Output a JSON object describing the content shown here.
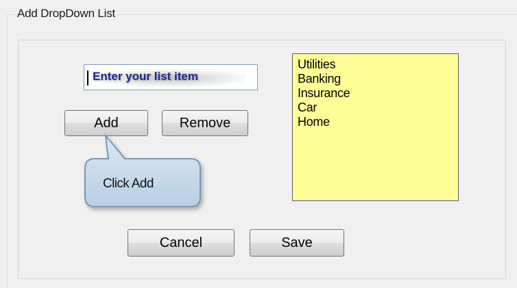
{
  "group": {
    "title": "Add DropDown List"
  },
  "input": {
    "placeholder": "Enter your list item",
    "value": ""
  },
  "buttons": {
    "add": "Add",
    "remove": "Remove",
    "cancel": "Cancel",
    "save": "Save"
  },
  "list": {
    "items": [
      "Utilities",
      "Banking",
      "Insurance",
      "Car",
      "Home"
    ],
    "background": "#ffff99"
  },
  "callout": {
    "text": "Click Add",
    "fill": "#c6d9ec",
    "border": "#7d97ad"
  },
  "theme": {
    "placeholder_color": "#1d2a8c"
  }
}
